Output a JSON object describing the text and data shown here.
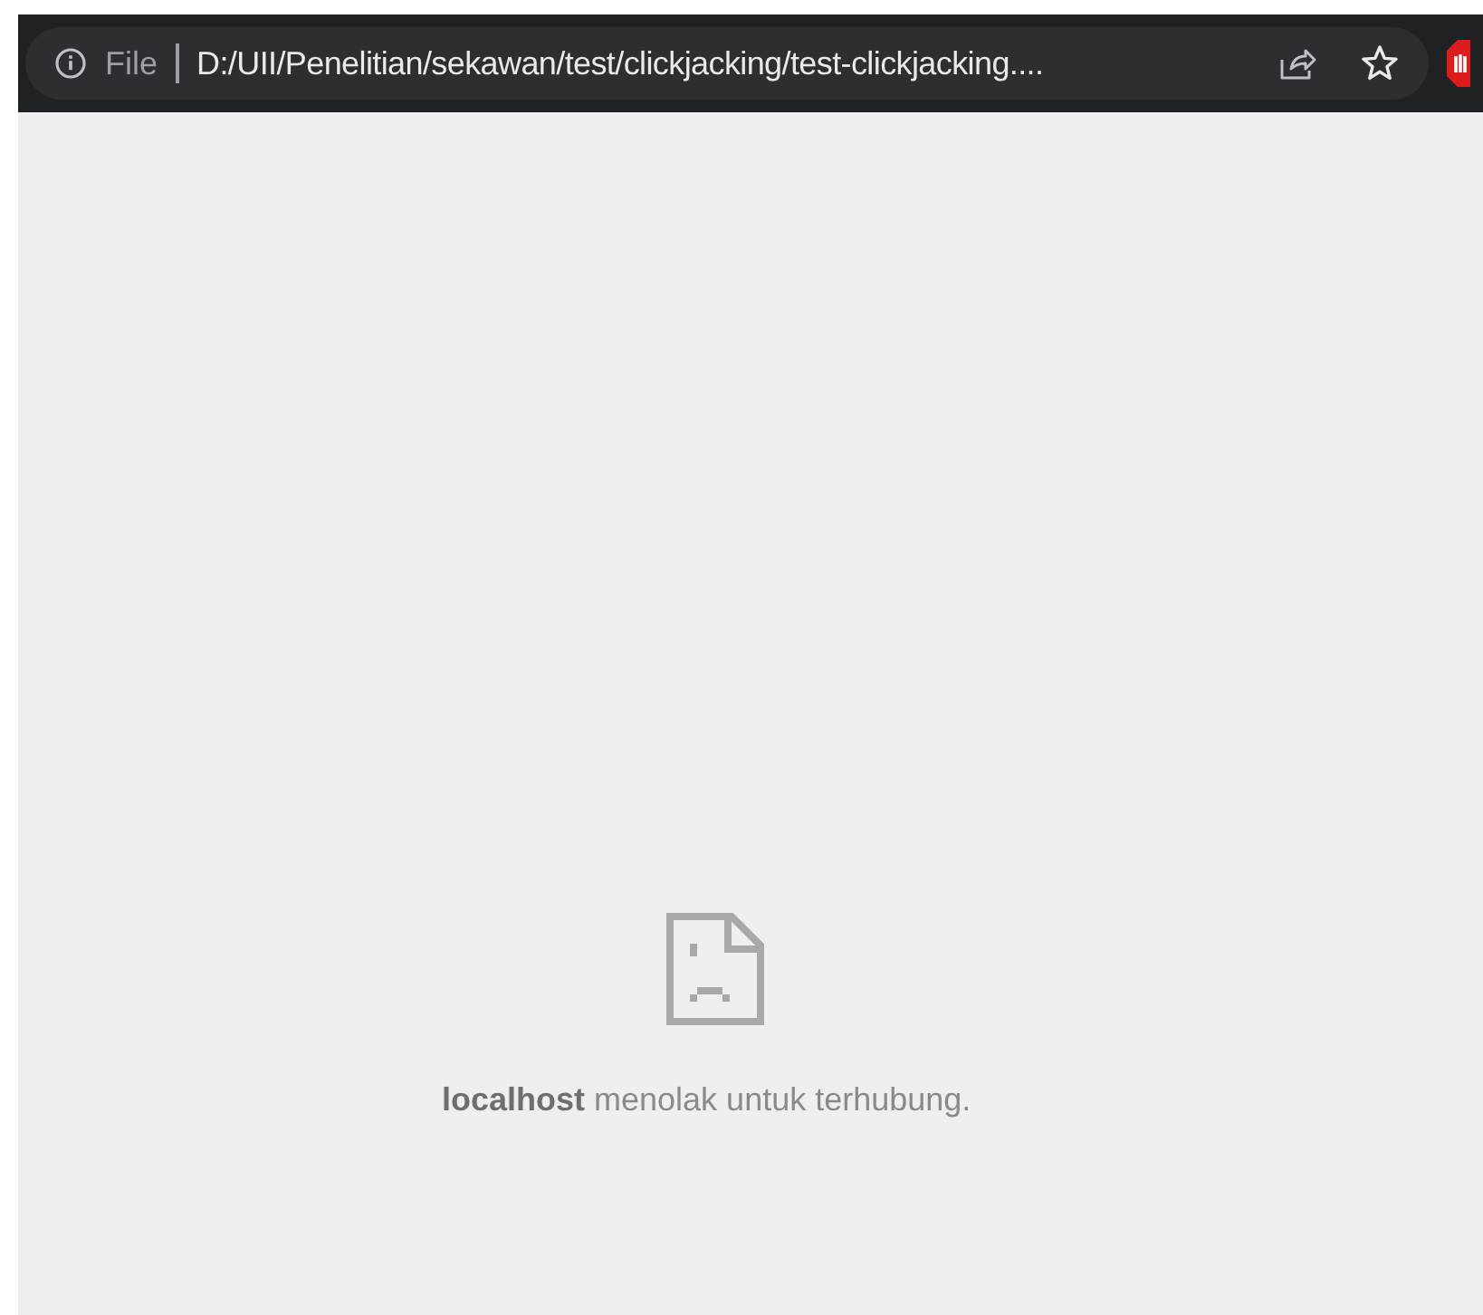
{
  "address_bar": {
    "scheme": "File",
    "url": "D:/UII/Penelitian/sekawan/test/clickjacking/test-clickjacking...."
  },
  "error": {
    "message": "**localhost** menolak untuk terhubung."
  }
}
